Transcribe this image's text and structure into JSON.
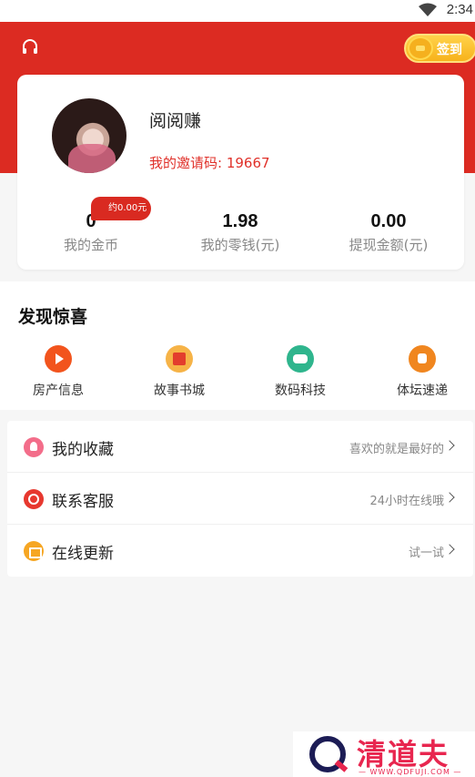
{
  "status_bar": {
    "time": "2:34"
  },
  "header": {
    "headset_icon": "headset-icon",
    "signin_label": "签到",
    "accent": "#dc2b22"
  },
  "profile": {
    "name": "阅阅赚",
    "invite_code": "我的邀请码: 19667",
    "stats": [
      {
        "value": "0",
        "label": "我的金币"
      },
      {
        "value": "1.98",
        "label": "我的零钱(元)"
      },
      {
        "value": "0.00",
        "label": "提现金额(元)"
      }
    ],
    "coin_badge": "约0.00元"
  },
  "discover": {
    "title": "发现惊喜",
    "categories": [
      {
        "label": "房产信息",
        "icon": "play-icon"
      },
      {
        "label": "故事书城",
        "icon": "book-icon"
      },
      {
        "label": "数码科技",
        "icon": "gamepad-icon"
      },
      {
        "label": "体坛速递",
        "icon": "bag-icon"
      }
    ]
  },
  "menu": [
    {
      "label": "我的收藏",
      "hint": "喜欢的就是最好的",
      "icon": "favorite-icon"
    },
    {
      "label": "联系客服",
      "hint": "24小时在线哦",
      "icon": "service-icon"
    },
    {
      "label": "在线更新",
      "hint": "试一试",
      "icon": "update-icon"
    }
  ],
  "watermark": {
    "brand": "清道夫",
    "url": "— WWW.QDFUJI.COM —"
  }
}
